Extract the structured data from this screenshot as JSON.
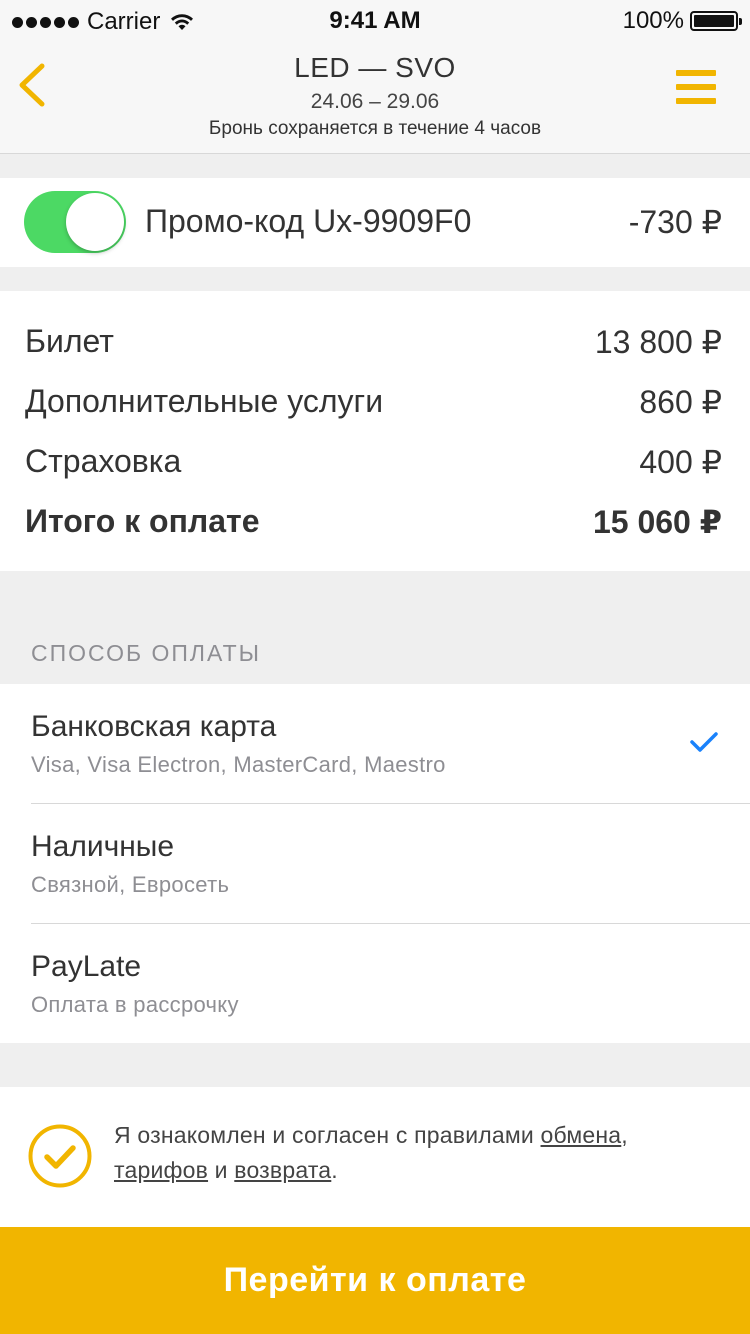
{
  "status_bar": {
    "carrier": "Carrier",
    "time": "9:41 AM",
    "battery": "100%"
  },
  "nav": {
    "route": "LED — SVO",
    "dates": "24.06 – 29.06",
    "hold_note": "Бронь сохраняется в течение 4 часов",
    "back_icon": "chevron-left-icon",
    "menu_icon": "hamburger-menu-icon"
  },
  "promo": {
    "enabled": true,
    "label": "Промо-код Ux-9909F0",
    "value": "-730 ₽"
  },
  "prices": [
    {
      "label": "Билет",
      "value": "13 800 ₽"
    },
    {
      "label": "Дополнительные услуги",
      "value": "860 ₽"
    },
    {
      "label": "Страховка",
      "value": "400 ₽"
    },
    {
      "label": "Итого к оплате",
      "value": "15 060 ₽"
    }
  ],
  "payment": {
    "header": "СПОСОБ ОПЛАТЫ",
    "options": [
      {
        "title": "Банковская карта",
        "subtitle": "Visa, Visa Electron, MasterCard, Maestro",
        "selected": true
      },
      {
        "title": "Наличные",
        "subtitle": "Связной, Евросеть",
        "selected": false
      },
      {
        "title": "PayLate",
        "subtitle": "Оплата в рассрочку",
        "selected": false
      }
    ]
  },
  "agreement": {
    "checked": true,
    "text_before": "Я ознакомлен и согласен с правилами ",
    "link_exchange": "обмена",
    "sep1": ", ",
    "link_tariffs": "тарифов",
    "sep2": " и ",
    "link_refund": "возврата",
    "text_after": "."
  },
  "cta": {
    "label": "Перейти к оплате"
  },
  "colors": {
    "accent": "#f1b500",
    "toggle_on": "#4cd964",
    "check_blue": "#1a82fb"
  }
}
